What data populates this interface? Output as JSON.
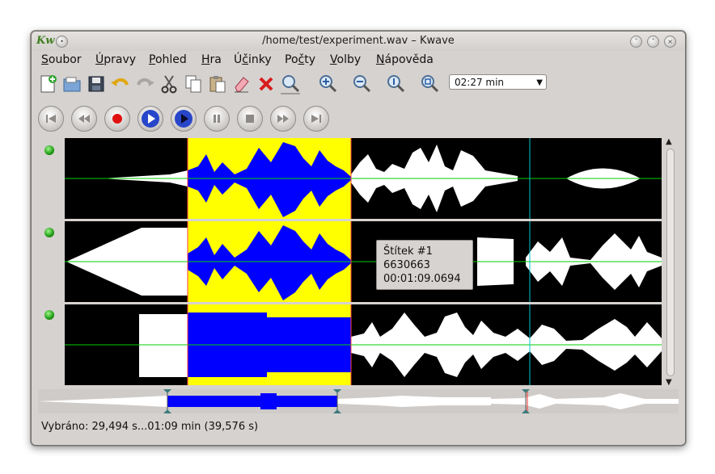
{
  "window": {
    "title": "/home/test/experiment.wav – Kwave",
    "logo": "Kw"
  },
  "menu": [
    {
      "pre": "",
      "u": "S",
      "post": "oubor"
    },
    {
      "pre": "",
      "u": "Ú",
      "post": "pravy"
    },
    {
      "pre": "",
      "u": "P",
      "post": "ohled"
    },
    {
      "pre": "",
      "u": "H",
      "post": "ra"
    },
    {
      "pre": "Ú",
      "u": "č",
      "post": "inky"
    },
    {
      "pre": "Po",
      "u": "č",
      "post": "ty"
    },
    {
      "pre": "",
      "u": "V",
      "post": "olby"
    },
    {
      "pre": "",
      "u": "N",
      "post": "ápověda"
    }
  ],
  "toolbar": {
    "icons": [
      "new-file-icon",
      "open-file-icon",
      "save-icon",
      "undo-icon",
      "redo-icon",
      "cut-icon",
      "copy-icon",
      "paste-icon",
      "erase-icon",
      "delete-icon",
      "zoom-selection-icon",
      "zoom-in-icon",
      "zoom-out-icon",
      "zoom-normal-icon",
      "zoom-all-icon"
    ],
    "zoom_value": "02:27 min"
  },
  "transport": {
    "icons": [
      "skip-start-icon",
      "rewind-icon",
      "record-icon",
      "play-icon",
      "loop-play-icon",
      "pause-icon",
      "stop-icon",
      "forward-icon",
      "skip-end-icon"
    ]
  },
  "tooltip": {
    "line1": "Štítek #1",
    "line2": "6630663",
    "line3": "00:01:09.0694"
  },
  "status": {
    "selection": "Vybráno: 29,494 s...01:09 min  (39,576 s)"
  },
  "colors": {
    "selection": "#ffff00",
    "wave_selected": "#0000ff",
    "wave": "#ffffff",
    "zero_line": "#00d000",
    "track_bg": "#000000",
    "marker": "#00c8c8"
  }
}
